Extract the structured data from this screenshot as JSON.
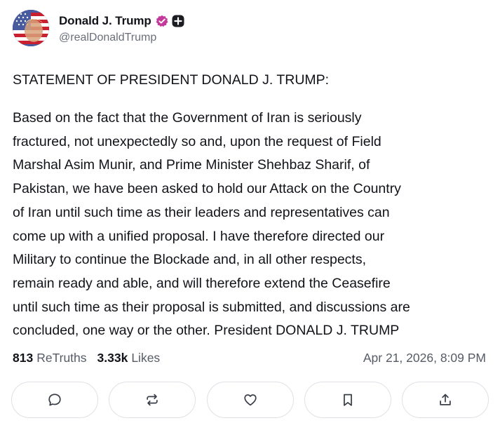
{
  "author": {
    "display_name": "Donald J. Trump",
    "handle": "@realDonaldTrump",
    "avatar_icon": "avatar-image",
    "verified_icon": "verified-badge-icon",
    "plus_icon": "plus-badge-icon",
    "verified_color": "#c43a9b"
  },
  "post": {
    "title": "STATEMENT OF PRESIDENT DONALD J. TRUMP:",
    "lines": [
      "Based on the fact that the Government of Iran is seriously",
      "fractured, not unexpectedly so and, upon the request of Field",
      "Marshal Asim Munir, and Prime Minister Shehbaz Sharif, of",
      "Pakistan, we have been asked to hold our Attack on the Country",
      "of Iran until such time as their leaders and representatives can",
      "come up with a unified proposal. I have therefore directed our",
      "Military to continue the Blockade and, in all other respects,",
      "remain ready and able, and will therefore extend the Ceasefire",
      "until such time as their proposal is submitted, and discussions are",
      "concluded, one way or the other. President DONALD J. TRUMP"
    ]
  },
  "stats": {
    "retruths_count": "813",
    "retruths_label": "ReTruths",
    "likes_count": "3.33k",
    "likes_label": "Likes",
    "timestamp": "Apr 21, 2026, 8:09 PM"
  },
  "actions": [
    {
      "name": "reply-button",
      "icon": "comment-icon"
    },
    {
      "name": "retruth-button",
      "icon": "retruth-icon"
    },
    {
      "name": "like-button",
      "icon": "heart-icon"
    },
    {
      "name": "bookmark-button",
      "icon": "bookmark-icon"
    },
    {
      "name": "share-button",
      "icon": "share-icon"
    }
  ],
  "colors": {
    "text": "#111318",
    "muted": "#565b66",
    "button_border": "#dfe1e6",
    "icon": "#3a3f4a"
  }
}
